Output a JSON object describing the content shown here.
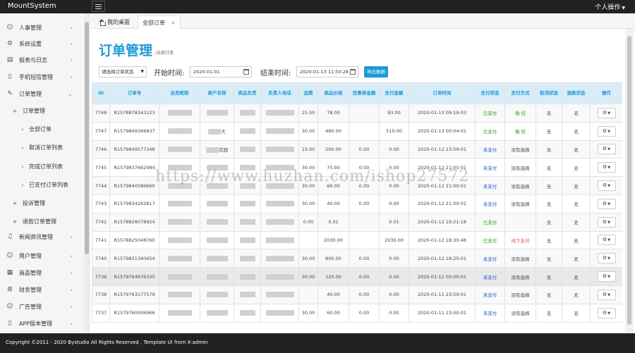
{
  "app": {
    "brand": "MountSystem",
    "user_menu": "个人操作"
  },
  "sidebar": {
    "items": [
      {
        "label": "人事管理",
        "icon": "user-icon",
        "chevron": "‹"
      },
      {
        "label": "系统设置",
        "icon": "gear-icon",
        "chevron": "‹"
      },
      {
        "label": "报表与日志",
        "icon": "report-icon",
        "chevron": "‹"
      },
      {
        "label": "手机短信管理",
        "icon": "mobile-icon",
        "chevron": "‹"
      },
      {
        "label": "订单管理",
        "icon": "edit-icon",
        "chevron": "⌄"
      },
      {
        "label": "订单管理",
        "icon": "plus-icon",
        "chevron": ""
      },
      {
        "label": "全部订单",
        "icon": "chevron-right-icon",
        "chevron": ""
      },
      {
        "label": "取消订单列表",
        "icon": "chevron-right-icon",
        "chevron": ""
      },
      {
        "label": "完成订单列表",
        "icon": "chevron-right-icon",
        "chevron": ""
      },
      {
        "label": "已支付订单列表",
        "icon": "chevron-right-icon",
        "chevron": ""
      },
      {
        "label": "投诉管理",
        "icon": "plus-icon",
        "chevron": ""
      },
      {
        "label": "退款订单管理",
        "icon": "plus-icon",
        "chevron": ""
      },
      {
        "label": "新闻资讯管理",
        "icon": "bell-icon",
        "chevron": "‹"
      },
      {
        "label": "用户管理",
        "icon": "user-icon",
        "chevron": "‹"
      },
      {
        "label": "商品管理",
        "icon": "goods-icon",
        "chevron": "‹"
      },
      {
        "label": "财务管理",
        "icon": "grid-icon",
        "chevron": "‹"
      },
      {
        "label": "广告管理",
        "icon": "smile-icon",
        "chevron": "‹"
      },
      {
        "label": "APP版本管理",
        "icon": "mobile-icon",
        "chevron": "‹"
      }
    ]
  },
  "tabs": {
    "home": "我的桌面",
    "active": "全部订单",
    "close": "×"
  },
  "page": {
    "title": "订单管理",
    "subtitle": "/全部订单",
    "status_select": "请选择订单状态",
    "start_label": "开始时间:",
    "start_value": "2020-01-01",
    "end_label": "结束时间:",
    "end_value": "2020-01-13 11:50:28",
    "export_button": "导出数据"
  },
  "table": {
    "headers": [
      "ID",
      "订单号",
      "会员昵称",
      "商户名称",
      "商品负责",
      "负责人电话",
      "运费",
      "商品价格",
      "优惠券金额",
      "支付金额",
      "订单时间",
      "支付状态",
      "支付方式",
      "取消状态",
      "退款状态",
      "操作"
    ],
    "rows": [
      {
        "id": "7748",
        "no": "R1578878343123",
        "shop": "",
        "ship": "15.00",
        "price": "78.00",
        "coupon": "",
        "pay": "93.00",
        "time": "2020-01-13 09:19:03",
        "status": "已支付",
        "method": "微 信",
        "cancel": "无",
        "refund": "无"
      },
      {
        "id": "7747",
        "no": "R1579849366837",
        "shop": "大",
        "ship": "30.00",
        "price": "480.00",
        "coupon": "",
        "pay": "510.00",
        "time": "2020-01-13 00:04:01",
        "status": "已支付",
        "method": "微 信",
        "cancel": "无",
        "refund": "无"
      },
      {
        "id": "7746",
        "no": "R1579849577348",
        "shop": "花园",
        "ship": "15.00",
        "price": "200.00",
        "coupon": "0.00",
        "pay": "0.00",
        "time": "2020-01-12 23:59:01",
        "status": "未支付",
        "method": "没有选择",
        "cancel": "无",
        "refund": "无"
      },
      {
        "id": "7745",
        "no": "R1579837662984",
        "shop": "",
        "ship": "30.00",
        "price": "75.00",
        "coupon": "0.00",
        "pay": "0.00",
        "time": "2020-01-12 21:05:01",
        "status": "未支付",
        "method": "没有选择",
        "cancel": "无",
        "refund": "无"
      },
      {
        "id": "7744",
        "no": "R1579840586660",
        "shop": "",
        "ship": "30.00",
        "price": "60.00",
        "coupon": "0.00",
        "pay": "0.00",
        "time": "2020-01-12 21:00:01",
        "status": "未支付",
        "method": "没有选择",
        "cancel": "无",
        "refund": "无"
      },
      {
        "id": "7743",
        "no": "R1579834262817",
        "shop": "",
        "ship": "30.00",
        "price": "40.00",
        "coupon": "0.00",
        "pay": "0.00",
        "time": "2020-01-12 21:00:01",
        "status": "未支付",
        "method": "没有选择",
        "cancel": "无",
        "refund": "无"
      },
      {
        "id": "7742",
        "no": "R1578828078924",
        "shop": "",
        "ship": "0.00",
        "price": "0.01",
        "coupon": "",
        "pay": "0.01",
        "time": "2020-01-12 19:21:18",
        "status": "已支付",
        "method": "",
        "cancel": "无",
        "refund": "无"
      },
      {
        "id": "7741",
        "no": "R1578825048760",
        "shop": "",
        "ship": "",
        "price": "2030.00",
        "coupon": "",
        "pay": "2030.00",
        "time": "2020-01-12 18:30:48",
        "status": "已支付",
        "method": "线下支付",
        "cancel": "无",
        "refund": "无"
      },
      {
        "id": "7740",
        "no": "R1579831360654",
        "shop": "",
        "ship": "30.00",
        "price": "800.00",
        "coupon": "0.00",
        "pay": "0.00",
        "time": "2020-01-12 18:25:01",
        "status": "未支付",
        "method": "没有选择",
        "cancel": "无",
        "refund": "无"
      },
      {
        "id": "7739",
        "no": "R1579764976335",
        "shop": "",
        "ship": "30.00",
        "price": "120.00",
        "coupon": "0.00",
        "pay": "0.00",
        "time": "2020-01-12 00:00:01",
        "status": "未支付",
        "method": "没有选择",
        "cancel": "无",
        "refund": "无"
      },
      {
        "id": "7738",
        "no": "R1579763177579",
        "shop": "",
        "ship": "",
        "price": "40.00",
        "coupon": "0.00",
        "pay": "0.00",
        "time": "2020-01-11 23:59:01",
        "status": "未支付",
        "method": "没有选择",
        "cancel": "无",
        "refund": "无"
      },
      {
        "id": "7737",
        "no": "R1579760006966",
        "shop": "",
        "ship": "30.00",
        "price": "60.00",
        "coupon": "0.00",
        "pay": "0.00",
        "time": "2020-01-11 23:00:01",
        "status": "未支付",
        "method": "没有选择",
        "cancel": "无",
        "refund": "无"
      }
    ]
  },
  "watermark": "https://www.huzhan.com/ishop27572",
  "footer": "Copyright ©2011 - 2020 Bystudio All Rights Reserved , Template UI from X-admin",
  "colors": {
    "accent": "#1e9ad6",
    "paid": "#17a117",
    "unpaid": "#1a56c9",
    "offline": "#d9534f"
  }
}
